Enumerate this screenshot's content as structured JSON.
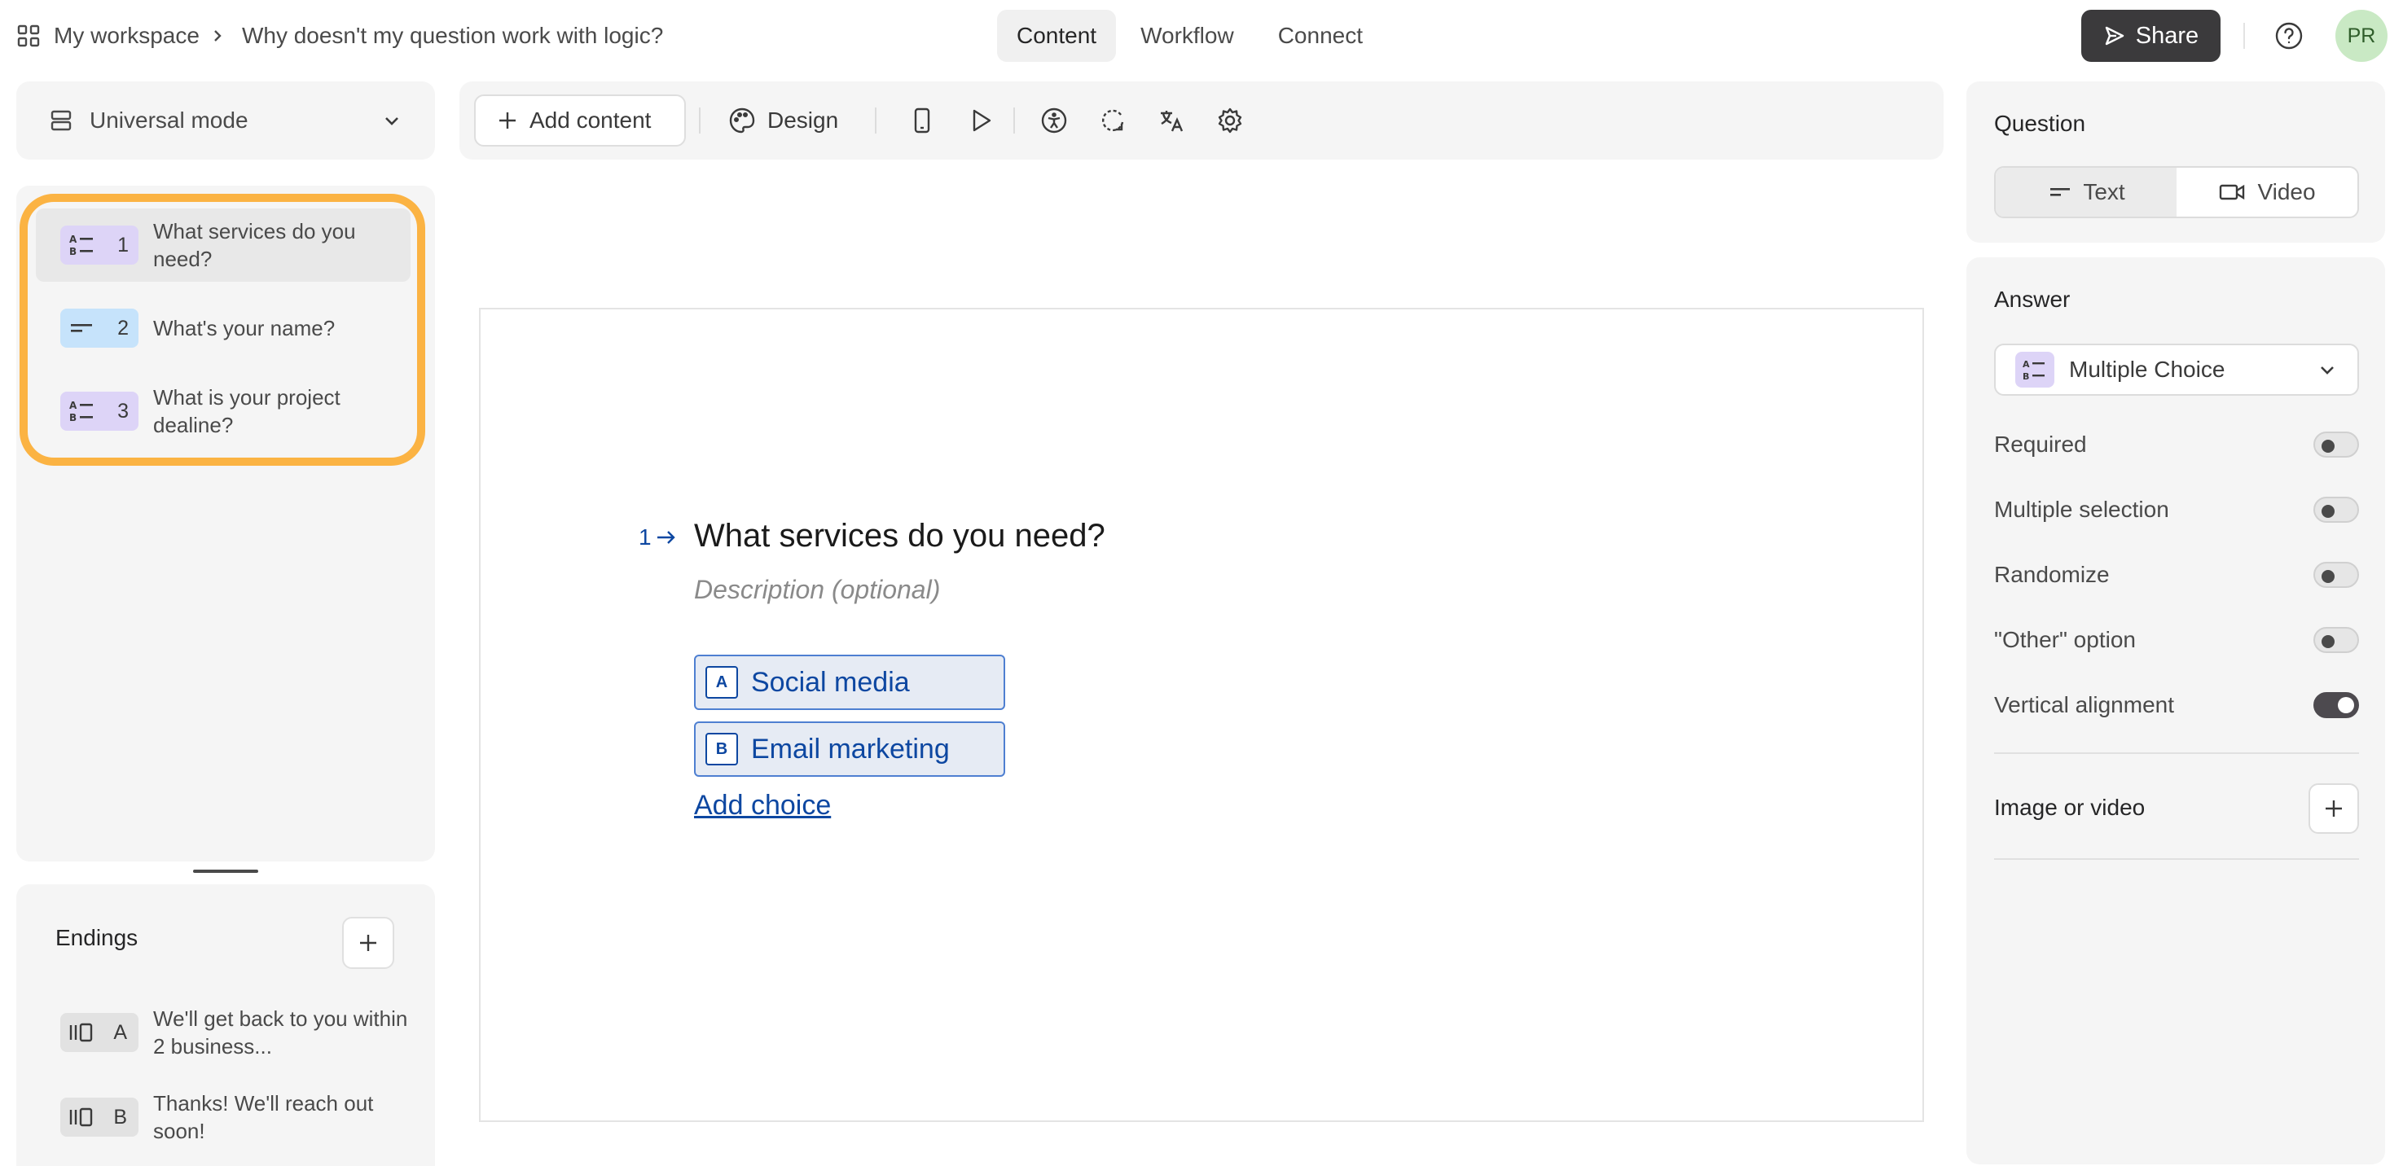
{
  "header": {
    "workspace": "My workspace",
    "form_title": "Why doesn't my question work with logic?",
    "tabs": [
      {
        "label": "Content",
        "active": true
      },
      {
        "label": "Workflow",
        "active": false
      },
      {
        "label": "Connect",
        "active": false
      }
    ],
    "share_label": "Share",
    "avatar_initials": "PR",
    "avatar_color": "#c9e9c4"
  },
  "left": {
    "mode_label": "Universal mode",
    "questions": [
      {
        "num": "1",
        "label": "What services do you need?",
        "type_icon": "multiple-choice-icon",
        "color": "#ddd4f7"
      },
      {
        "num": "2",
        "label": "What's your name?",
        "type_icon": "short-text-icon",
        "color": "#c6e3fb"
      },
      {
        "num": "3",
        "label": "What is your project dealine?",
        "type_icon": "multiple-choice-icon",
        "color": "#ddd4f7"
      }
    ],
    "highlight_color": "#fbb343",
    "endings_title": "Endings",
    "endings": [
      {
        "letter": "A",
        "label": "We'll get back to you within 2 business..."
      },
      {
        "letter": "B",
        "label": "Thanks! We'll reach out soon!"
      }
    ]
  },
  "toolbar": {
    "add_content_label": "Add content",
    "design_label": "Design",
    "icons": [
      "mobile-preview-icon",
      "play-icon",
      "accessibility-icon",
      "refresh-icon",
      "translate-icon",
      "settings-icon"
    ]
  },
  "canvas": {
    "question_number": "1",
    "question_title": "What services do you need?",
    "description_placeholder": "Description (optional)",
    "choices": [
      {
        "key": "A",
        "label": "Social media"
      },
      {
        "key": "B",
        "label": "Email marketing"
      }
    ],
    "add_choice_label": "Add choice",
    "accent_color": "#0d47a1"
  },
  "right": {
    "question_title": "Question",
    "question_types": [
      {
        "label": "Text",
        "active": true
      },
      {
        "label": "Video",
        "active": false
      }
    ],
    "answer_title": "Answer",
    "answer_type": "Multiple Choice",
    "options": [
      {
        "label": "Required",
        "on": false
      },
      {
        "label": "Multiple selection",
        "on": false
      },
      {
        "label": "Randomize",
        "on": false
      },
      {
        "label": "\"Other\" option",
        "on": false
      },
      {
        "label": "Vertical alignment",
        "on": true
      }
    ],
    "media_label": "Image or video"
  }
}
